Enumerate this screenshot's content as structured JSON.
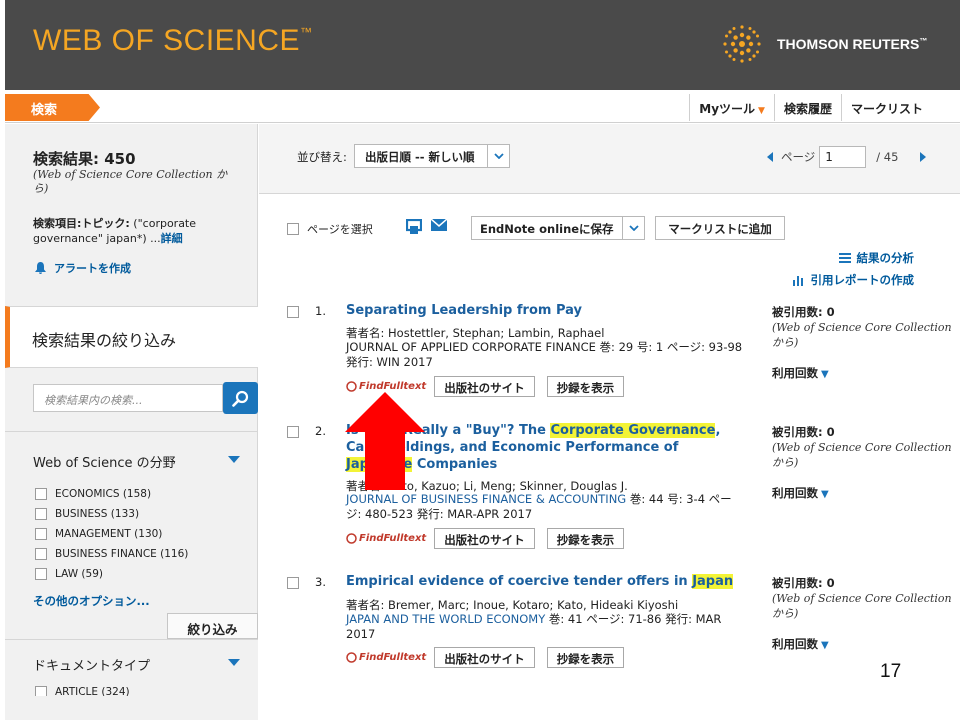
{
  "header": {
    "brand": "WEB OF SCIENCE",
    "brand_tm": "™",
    "publisher": "THOMSON REUTERS",
    "publisher_tm": "™"
  },
  "nav": {
    "search_tab": "検索",
    "my_tools": "Myツール",
    "history": "検索履歴",
    "marked_list": "マークリスト"
  },
  "sidebar": {
    "results_label": "検索結果: 450",
    "results_db": "(Web of Science Core Collection から)",
    "query_label": "検索項目:",
    "query_field": "トピック:",
    "query_text": " (\"corporate governance\" japan*) ...",
    "query_details": "詳細",
    "alert": "アラートを作成",
    "refine_title": "検索結果の絞り込み",
    "search_placeholder": "検索結果内の検索...",
    "wos_categories_title": "Web of Science の分野",
    "categories": [
      {
        "label": "ECONOMICS (158)"
      },
      {
        "label": "BUSINESS (133)"
      },
      {
        "label": "MANAGEMENT (130)"
      },
      {
        "label": "BUSINESS FINANCE (116)"
      },
      {
        "label": "LAW (59)"
      }
    ],
    "more_options": "その他のオプション...",
    "refine_button": "絞り込み",
    "doc_type_title": "ドキュメントタイプ",
    "doc_type_first": "ARTICLE (324)"
  },
  "main": {
    "sort_label": "並び替え:",
    "sort_value": "出版日順 -- 新しい順",
    "page_label": "ページ",
    "page_value": "1",
    "page_total": "/ 45",
    "select_page": "ページを選択",
    "save_endnote": "EndNote onlineに保存",
    "add_marked": "マークリストに追加",
    "analyze": "結果の分析",
    "citation_report": "引用レポートの作成",
    "find_fulltext": "FindFulltext",
    "publisher_site": "出版社のサイト",
    "abstract_show": "抄録を表示",
    "cited_label": "被引用数: 0",
    "cited_db": "(Web of Science Core Collection から)",
    "usage_label": "利用回数"
  },
  "records": [
    {
      "num": "1.",
      "title_parts": [
        "Separating Leadership from Pay"
      ],
      "authors": "著者名: Hostettler, Stephan; Lambin, Raphael",
      "journal": "JOURNAL OF APPLIED CORPORATE FINANCE",
      "details": " 巻: 29  号: 1  ページ: 93-98  発行: WIN 2017"
    },
    {
      "num": "2.",
      "title_a": "Is Cash Really a \"Buy\"? The ",
      "title_hl1": "Corporate Governance",
      "title_b": ", Cash Holdings, and Economic Performance of ",
      "title_hl2": "Japanese",
      "title_c": " Companies",
      "authors": "著者名: Kato, Kazuo; Li, Meng; Skinner, Douglas J.",
      "journal": "JOURNAL OF BUSINESS FINANCE & ACCOUNTING",
      "details": "  巻: 44  号: 3-4  ページ: 480-523  発行: MAR-APR 2017"
    },
    {
      "num": "3.",
      "title_a": "Empirical evidence of coercive tender offers in ",
      "title_hl": "Japan",
      "authors": "著者名: Bremer, Marc; Inoue, Kotaro; Kato, Hideaki Kiyoshi",
      "journal": "JAPAN AND THE WORLD ECONOMY",
      "details": "  巻: 41  ページ: 71-86  発行: MAR 2017"
    }
  ],
  "slide_number": "17",
  "colors": {
    "header_bg": "#4a4a4a",
    "brand_orange": "#f5a623",
    "accent_orange": "#f47b1e",
    "link_blue": "#1b5f9e",
    "highlight": "#f3f336",
    "arrow_red": "#ff0000"
  }
}
